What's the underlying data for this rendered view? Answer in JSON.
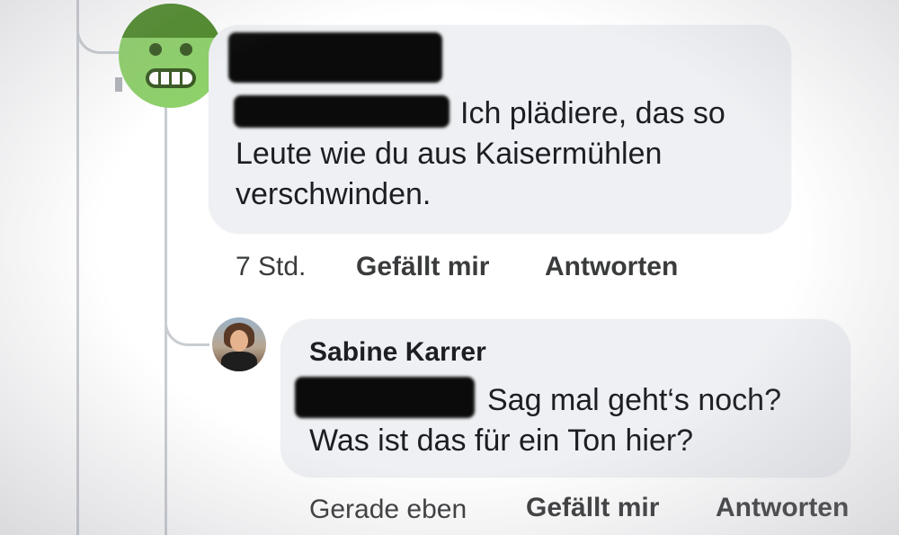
{
  "comment1": {
    "author_name": "",
    "text": "Ich plädiere, das so Leute wie du aus Kaisermühlen verschwinden.",
    "lines": [
      "Ich plädiere, das so",
      "Leute wie du aus Kaisermühlen",
      "verschwinden."
    ],
    "time": "7 Std.",
    "like_label": "Gefällt mir",
    "reply_label": "Antworten",
    "avatar_icon": "hulk-face-icon"
  },
  "comment2": {
    "author_name": "Sabine Karrer",
    "lines": [
      "Sag mal geht‘s noch?",
      "Was ist das für ein Ton hier?"
    ],
    "time": "Gerade eben",
    "like_label": "Gefällt mir",
    "reply_label": "Antworten",
    "avatar_icon": "profile-photo"
  },
  "colors": {
    "bubble": "#eef0f3",
    "thread_line": "#c9ccd1",
    "text": "#1c1e21",
    "meta": "#3a3b3c",
    "redaction": "#0b0b0b"
  }
}
